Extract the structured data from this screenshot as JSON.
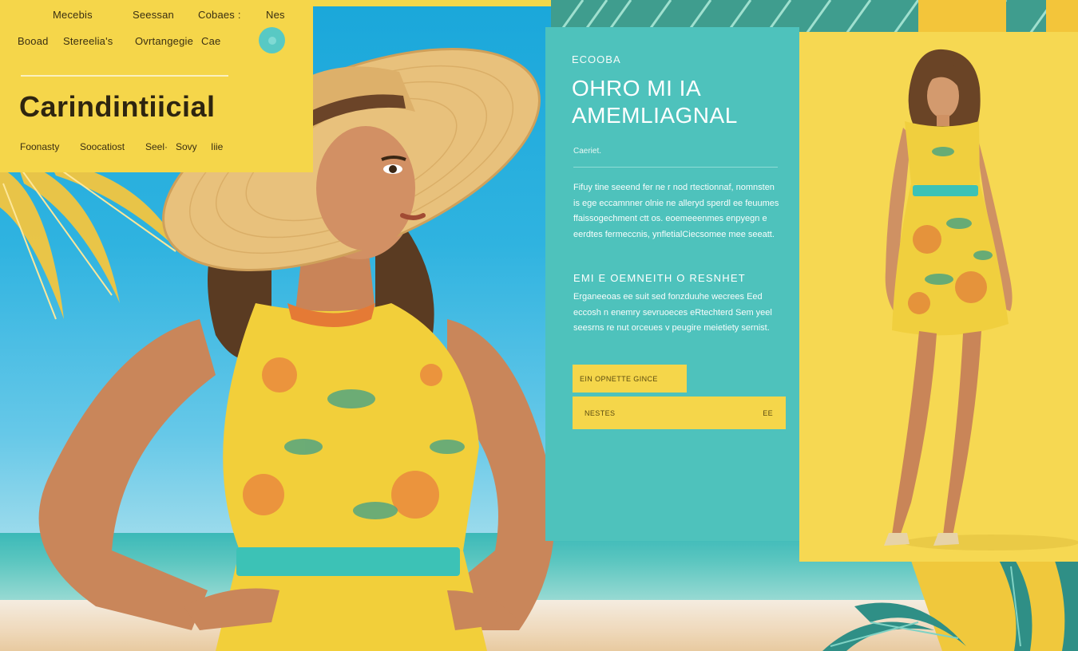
{
  "nav": {
    "top_links": [
      "Mecebis",
      "Seessan",
      "Cobaes :",
      "Nes"
    ],
    "second_links": [
      "Booad",
      "Stereelia's",
      "Ovrtangegie",
      "Cae"
    ],
    "brand_title": "Carindintiicial",
    "sub_links": [
      "Foonasty",
      "Soocatiost",
      "Seel·",
      "Sovy",
      "Iiie"
    ]
  },
  "info": {
    "eyebrow": "ECOOBA",
    "headline_line1": "OHRO MI IA",
    "headline_line2": "AMEMLIAGNAL",
    "caption": "Caeriet.",
    "paragraph1": "Fifuy tine seeend fer ne r nod rtectionnaf, nomnsten is ege eccamnner olnie ne alleryd sperdl ee feuumes ffaissogechment ctt os. eoemeeenmes enpyegn e eerdtes fermeccnis, ynfletialCiecsomee mee seeatt.",
    "subhead": "EMI E OEMNEITH O RESNHET",
    "paragraph2": "Erganeeoas ee suit sed fonzduuhe wecrees Eed eccosh n enemry sevruoeces eRtechterd Sem yeel seesrns re nut orceues v peugire meietiety sernist.",
    "button_primary": "EIN OPNETTE GINCE",
    "button_secondary_left": "NESTES",
    "button_secondary_right": "EE"
  },
  "colors": {
    "yellow": "#f5d64a",
    "teal": "#4ec2bc",
    "sky": "#1aa7da",
    "text_dark": "#3a2f12"
  }
}
